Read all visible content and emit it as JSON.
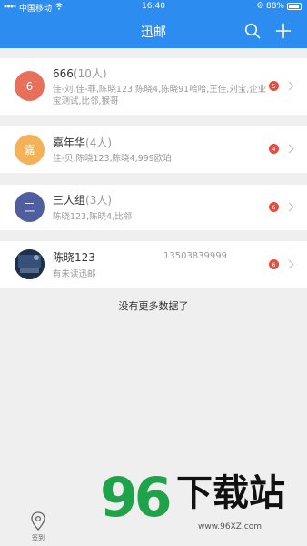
{
  "status": {
    "carrier": "中国移动",
    "time": "16:40",
    "battery": "88%"
  },
  "nav": {
    "title": "迅邮",
    "icons": [
      "search-icon",
      "plus-icon"
    ]
  },
  "groups": [
    {
      "avatar": "6",
      "avatar_color": "#e8705a",
      "name": "666",
      "count": "(10人)",
      "members": "佳-刘,佳-菲,陈晓123,陈晓4,陈晓91哈哈,王佳,刘宝,企业宝测试,比邻,猴哥",
      "unread": "5"
    },
    {
      "avatar": "嘉",
      "avatar_color": "#f3b25a",
      "name": "嘉年华",
      "count": "(4人)",
      "members": "佳-贝,陈晓123,陈晓4,999欧珀",
      "unread": "4"
    },
    {
      "avatar": "三",
      "avatar_color": "#4f5f9e",
      "name": "三人组",
      "count": "(3人)",
      "members": "陈晓123,陈晓4,比邻",
      "unread": "6"
    },
    {
      "avatar": "",
      "avatar_color": "#1e2f4a",
      "name": "陈晓123",
      "phone": "13503839999",
      "members": "有未读迅邮",
      "unread": "6"
    }
  ],
  "footer_text": "没有更多数据了",
  "watermark": {
    "number": "96",
    "text": "下载站",
    "url": "www.96XZ.com"
  },
  "tabbar": {
    "label": "签到"
  }
}
